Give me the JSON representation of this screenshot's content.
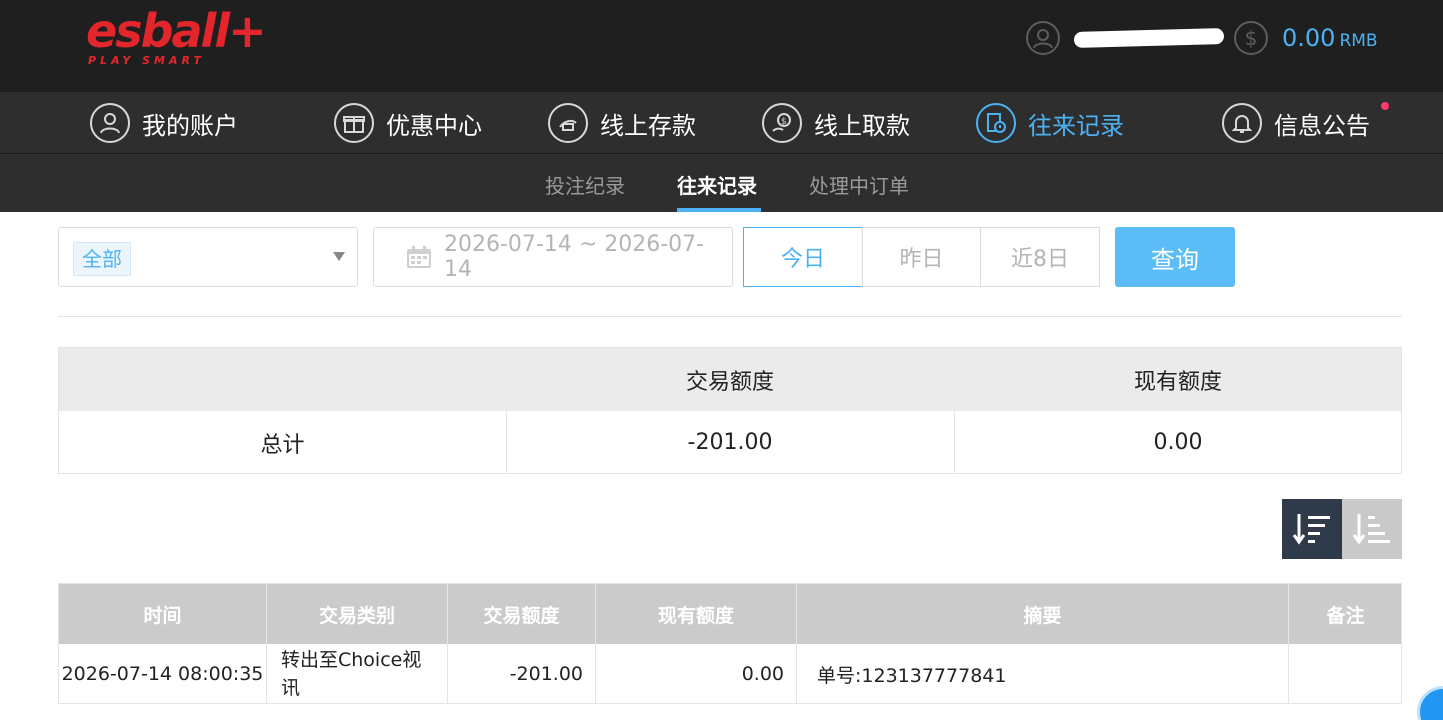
{
  "header": {
    "logo_text": "esball+",
    "logo_tagline": "PLAY SMART",
    "user_icon": "user-icon",
    "balance_icon": "dollar-icon",
    "balance_amount": "0.00",
    "balance_currency": "RMB"
  },
  "main_nav": {
    "items": [
      {
        "label": "我的账户",
        "icon": "user-icon"
      },
      {
        "label": "优惠中心",
        "icon": "gift-icon"
      },
      {
        "label": "线上存款",
        "icon": "deposit-icon"
      },
      {
        "label": "线上取款",
        "icon": "withdraw-icon"
      },
      {
        "label": "往来记录",
        "icon": "records-icon",
        "active": true
      },
      {
        "label": "信息公告",
        "icon": "bell-icon"
      }
    ]
  },
  "sub_nav": {
    "items": [
      {
        "label": "投注纪录"
      },
      {
        "label": "往来记录",
        "active": true
      },
      {
        "label": "处理中订单"
      }
    ]
  },
  "filters": {
    "type_select_value": "全部",
    "date_range": "2026-07-14 ~ 2026-07-14",
    "quick_ranges": [
      "今日",
      "昨日",
      "近8日"
    ],
    "active_quick_range": "今日",
    "query_label": "查询"
  },
  "summary": {
    "headers": [
      "",
      "交易额度",
      "现有额度"
    ],
    "row": {
      "label": "总计",
      "amount": "-201.00",
      "balance": "0.00"
    }
  },
  "sort": {
    "desc_icon": "sort-desc-icon",
    "asc_icon": "sort-asc-icon"
  },
  "records": {
    "headers": [
      "时间",
      "交易类别",
      "交易额度",
      "现有额度",
      "摘要",
      "备注"
    ],
    "rows": [
      {
        "time": "2026-07-14 08:00:35",
        "type": "转出至Choice视讯",
        "amount": "-201.00",
        "balance": "0.00",
        "summary": "单号:123137777841",
        "note": ""
      }
    ]
  },
  "colors": {
    "accent": "#4cb2f4",
    "topbar": "#1f1f1f",
    "nav": "#2e2e2e",
    "brand_red": "#e2262c"
  }
}
